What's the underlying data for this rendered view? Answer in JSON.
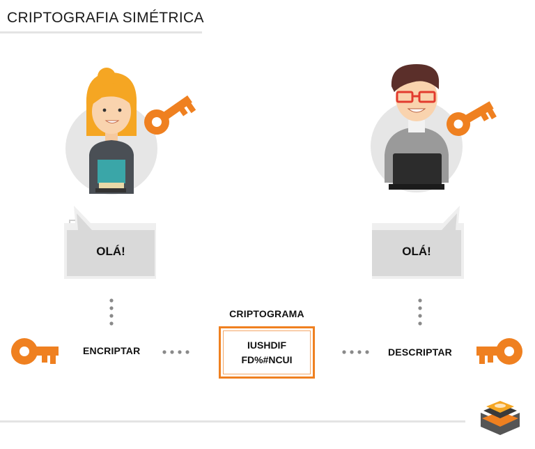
{
  "title": "CRIPTOGRAFIA SIMÉTRICA",
  "sender": {
    "message": "OLÁ!"
  },
  "receiver": {
    "message": "OLÁ!"
  },
  "flow": {
    "encrypt_label": "ENCRIPTAR",
    "decrypt_label": "DESCRIPTAR",
    "ciphertext_title": "CRIPTOGRAMA",
    "ciphertext_line1": "IUSHDIF",
    "ciphertext_line2": "FD%#NCUI"
  },
  "colors": {
    "accent": "#ef8020",
    "bubble": "#d9d9d9",
    "circle": "#e6e6e6"
  }
}
